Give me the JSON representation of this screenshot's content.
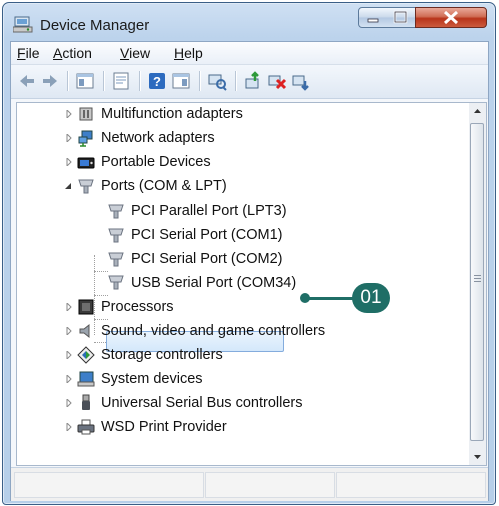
{
  "window": {
    "title": "Device Manager"
  },
  "menu": {
    "file": "File",
    "action": "Action",
    "view": "View",
    "help": "Help"
  },
  "tree": {
    "items": [
      {
        "label": "Multifunction adapters",
        "icon": "multifunction-icon"
      },
      {
        "label": "Network adapters",
        "icon": "network-icon"
      },
      {
        "label": "Portable Devices",
        "icon": "portable-devices-icon"
      },
      {
        "label": "Ports (COM & LPT)",
        "icon": "port-icon"
      },
      {
        "label": "PCI Parallel Port (LPT3)",
        "icon": "port-icon"
      },
      {
        "label": "PCI Serial Port (COM1)",
        "icon": "port-icon"
      },
      {
        "label": "PCI Serial Port (COM2)",
        "icon": "port-icon"
      },
      {
        "label": "USB Serial Port (COM34)",
        "icon": "port-icon"
      },
      {
        "label": "Processors",
        "icon": "processor-icon"
      },
      {
        "label": "Sound, video and game controllers",
        "icon": "speaker-icon"
      },
      {
        "label": "Storage controllers",
        "icon": "storage-icon"
      },
      {
        "label": "System devices",
        "icon": "system-icon"
      },
      {
        "label": "Universal Serial Bus controllers",
        "icon": "usb-icon"
      },
      {
        "label": "WSD Print Provider",
        "icon": "printer-icon"
      }
    ]
  },
  "callout": {
    "label": "01",
    "color": "#1f6e66"
  },
  "colors": {
    "selection_border": "#84acdd",
    "title_gradient": "#bcd3ec"
  }
}
